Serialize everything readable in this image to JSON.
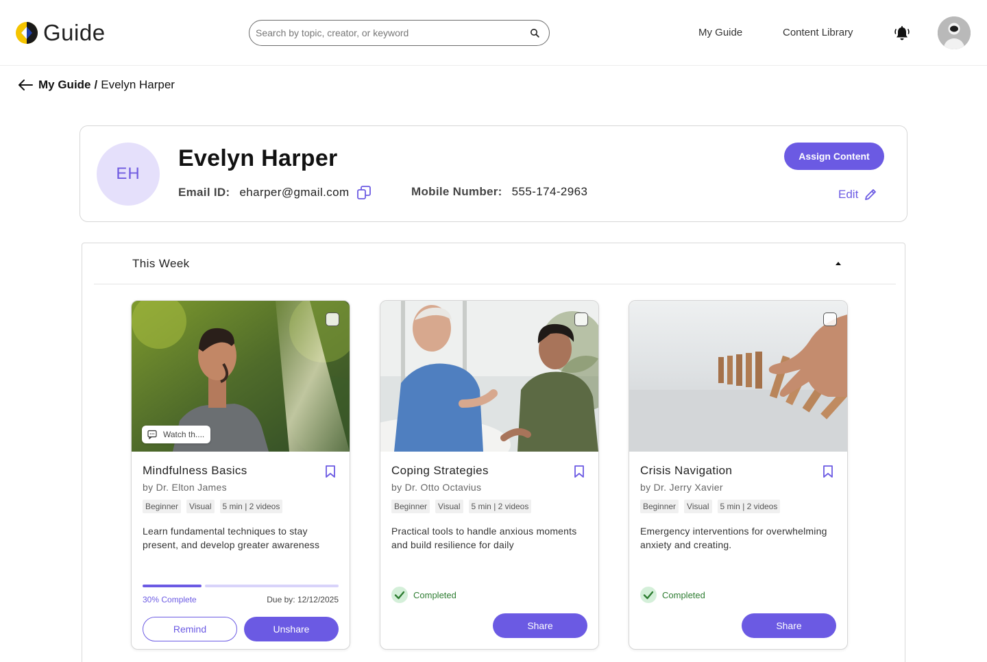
{
  "header": {
    "app_name": "Guide",
    "search_placeholder": "Search by topic, creator, or keyword",
    "nav": [
      "My Guide",
      "Content Library"
    ]
  },
  "breadcrumb": {
    "parent": "My Guide",
    "separator": "/",
    "current": "Evelyn Harper"
  },
  "profile": {
    "initials": "EH",
    "name": "Evelyn Harper",
    "email_label": "Email ID:",
    "email": "eharper@gmail.com",
    "mobile_label": "Mobile Number:",
    "mobile": "555-174-2963",
    "assign_button": "Assign Content",
    "edit_label": "Edit"
  },
  "section": {
    "title": "This Week"
  },
  "cards": [
    {
      "title": "Mindfulness Basics",
      "author": "by Dr. Elton James",
      "tags": [
        "Beginner",
        "Visual",
        "5 min | 2 videos"
      ],
      "description": "Learn fundamental techniques to stay present, and develop greater awareness",
      "watch_chip": "Watch th....",
      "progress": 0.3,
      "progress_label": "30% Complete",
      "due": "Due by: 12/12/2025",
      "remind_button": "Remind",
      "unshare_button": "Unshare"
    },
    {
      "title": "Coping Strategies",
      "author": "by Dr. Otto Octavius",
      "tags": [
        "Beginner",
        "Visual",
        "5 min | 2 videos"
      ],
      "description": "Practical tools to handle anxious moments and build resilience for daily",
      "status": "Completed",
      "share_button": "Share"
    },
    {
      "title": "Crisis Navigation",
      "author": "by Dr. Jerry Xavier",
      "tags": [
        "Beginner",
        "Visual",
        "5 min | 2 videos"
      ],
      "description": "Emergency interventions for overwhelming anxiety and creating.",
      "status": "Completed",
      "share_button": "Share"
    }
  ],
  "colors": {
    "accent": "#6b5ae3",
    "accent_light": "#e5e0fb",
    "success": "#2e7d32",
    "logo_yellow": "#f5c400",
    "logo_blue": "#1f3fa8"
  }
}
